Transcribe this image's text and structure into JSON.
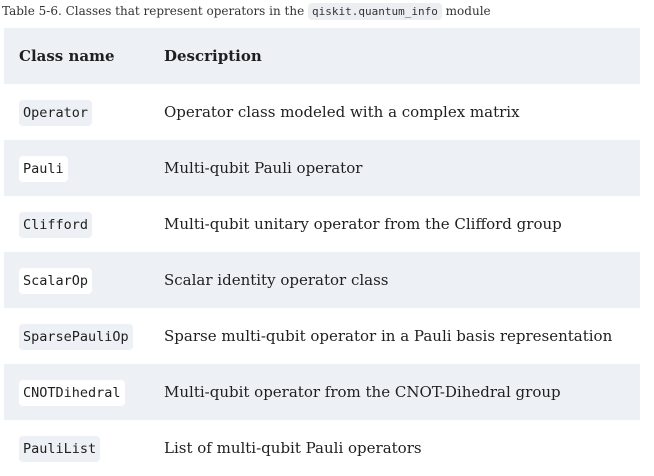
{
  "caption": {
    "prefix": "Table 5-6. Classes that represent operators in the ",
    "module": "qiskit.quantum_info",
    "suffix": " module"
  },
  "headers": [
    "Class name",
    "Description"
  ],
  "rows": [
    {
      "name": "Operator",
      "desc": "Operator class modeled with a complex matrix"
    },
    {
      "name": "Pauli",
      "desc": "Multi-qubit Pauli operator"
    },
    {
      "name": "Clifford",
      "desc": "Multi-qubit unitary operator from the Clifford group"
    },
    {
      "name": "ScalarOp",
      "desc": "Scalar identity operator class"
    },
    {
      "name": "SparsePauliOp",
      "desc": "Sparse multi-qubit operator in a Pauli basis representation"
    },
    {
      "name": "CNOTDihedral",
      "desc": "Multi-qubit operator from the CNOT-Dihedral group"
    },
    {
      "name": "PauliList",
      "desc": "List of multi-qubit Pauli operators"
    }
  ]
}
